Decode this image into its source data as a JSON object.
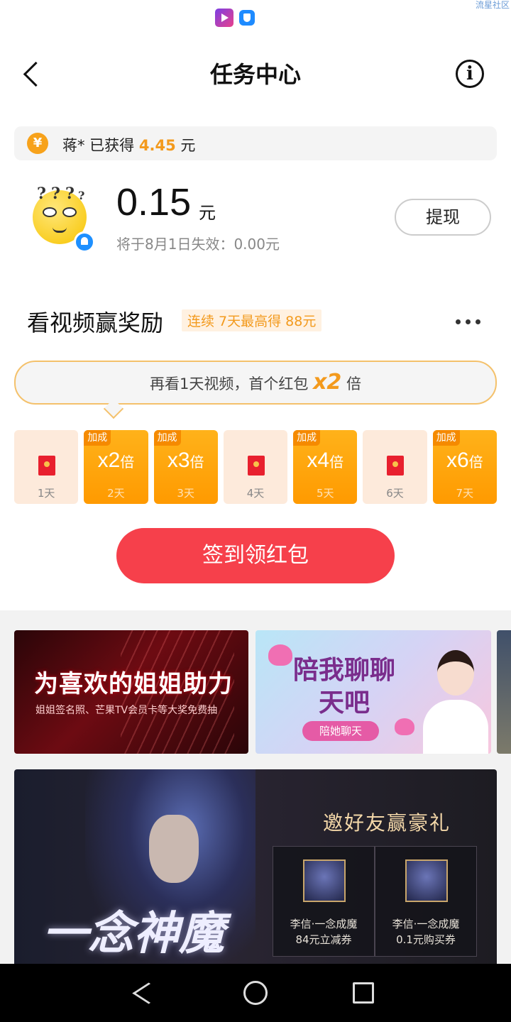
{
  "status_bar": {
    "watermark": "流星社区",
    "icons": [
      "video-app-icon",
      "shield-app-icon"
    ]
  },
  "nav": {
    "title": "任务中心",
    "back_icon": "chevron-left-icon",
    "info_icon": "info-icon",
    "info_glyph": "i"
  },
  "earned": {
    "coin_glyph": "¥",
    "prefix": "蒋* 已获得",
    "amount": "4.45",
    "unit": "元"
  },
  "balance": {
    "amount": "0.15",
    "unit": "元",
    "expire": "将于8月1日失效：0.00元",
    "withdraw_label": "提现",
    "emoji_glyph": "?"
  },
  "video_reward": {
    "title": "看视频赢奖励",
    "tag": "连续 7天最高得 88元",
    "bubble_prefix": "再看1天视频，首个红包",
    "bubble_mult": "x2",
    "bubble_suffix": "倍"
  },
  "days": [
    {
      "label": "1天",
      "type": "envelope"
    },
    {
      "label": "2天",
      "type": "bonus",
      "tag": "加成",
      "mult": "x2",
      "unit": "倍"
    },
    {
      "label": "3天",
      "type": "bonus",
      "tag": "加成",
      "mult": "x3",
      "unit": "倍"
    },
    {
      "label": "4天",
      "type": "envelope"
    },
    {
      "label": "5天",
      "type": "bonus",
      "tag": "加成",
      "mult": "x4",
      "unit": "倍"
    },
    {
      "label": "6天",
      "type": "envelope"
    },
    {
      "label": "7天",
      "type": "bonus",
      "tag": "加成",
      "mult": "x6",
      "unit": "倍"
    }
  ],
  "signin_label": "签到领红包",
  "banners": [
    {
      "title": "为喜欢的姐姐助力",
      "subtitle": "姐姐签名照、芒果TV会员卡等大奖免费抽"
    },
    {
      "title": "陪我聊聊天吧",
      "button": "陪她聊天"
    }
  ],
  "promo": {
    "calligraphy": "一念神魔",
    "heading": "邀好友赢豪礼",
    "coupons": [
      {
        "name": "李信·一念成魔",
        "desc": "84元立减券"
      },
      {
        "name": "李信·一念成魔",
        "desc": "0.1元购买券"
      }
    ]
  },
  "system_nav": {
    "back": "nav-back-icon",
    "home": "nav-home-icon",
    "recent": "nav-recent-icon"
  },
  "colors": {
    "accent_orange": "#f39a1d",
    "signin_red": "#f6404b",
    "bonus_orange": "#ffa60d"
  }
}
